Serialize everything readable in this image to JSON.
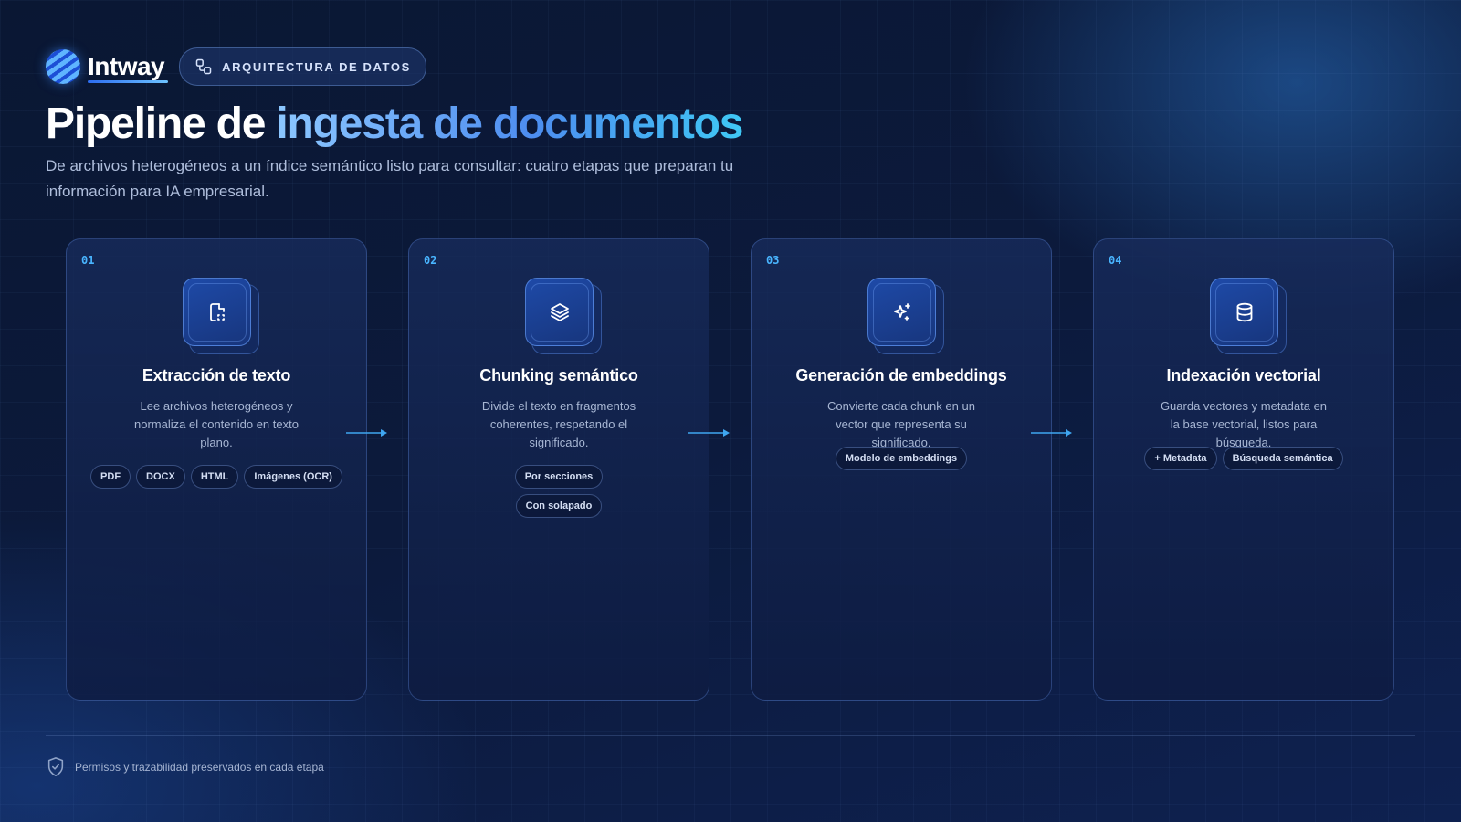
{
  "brand": {
    "name": "Intway",
    "logo_icon": "intway-sphere-logo"
  },
  "badge": {
    "label": "ARQUITECTURA DE DATOS",
    "icon": "workflow-icon"
  },
  "heading": {
    "title_plain": "Pipeline de ",
    "title_accent": "ingesta de documentos",
    "subtitle": "De archivos heterogéneos a un índice semántico listo para consultar: cuatro etapas que preparan tu información para IA empresarial."
  },
  "steps": [
    {
      "number": "01",
      "icon": "file-scan-icon",
      "title": "Extracción de texto",
      "description": "Lee archivos heterogéneos y normaliza el contenido en texto plano.",
      "tags": [
        "PDF",
        "DOCX",
        "HTML",
        "Imágenes (OCR)"
      ]
    },
    {
      "number": "02",
      "icon": "layers-icon",
      "title": "Chunking semántico",
      "description": "Divide el texto en fragmentos coherentes, respetando el significado.",
      "tags": [
        "Por secciones",
        "Con solapado"
      ]
    },
    {
      "number": "03",
      "icon": "sparkles-icon",
      "title": "Generación de embeddings",
      "description": "Convierte cada chunk en un vector que representa su significado.",
      "tags": [
        "Modelo de embeddings"
      ]
    },
    {
      "number": "04",
      "icon": "database-icon",
      "title": "Indexación vectorial",
      "description": "Guarda vectores y metadata en la base vectorial, listos para búsqueda.",
      "tags": [
        "+ Metadata",
        "Búsqueda semántica"
      ]
    }
  ],
  "footer": {
    "text": "Permisos y trazabilidad preservados en cada etapa",
    "icon": "shield-check-icon"
  },
  "colors": {
    "accent": "#4d8df0",
    "accent_cyan": "#3fc8f5",
    "background": "#0a1634",
    "step_number": "#49b5ff"
  }
}
